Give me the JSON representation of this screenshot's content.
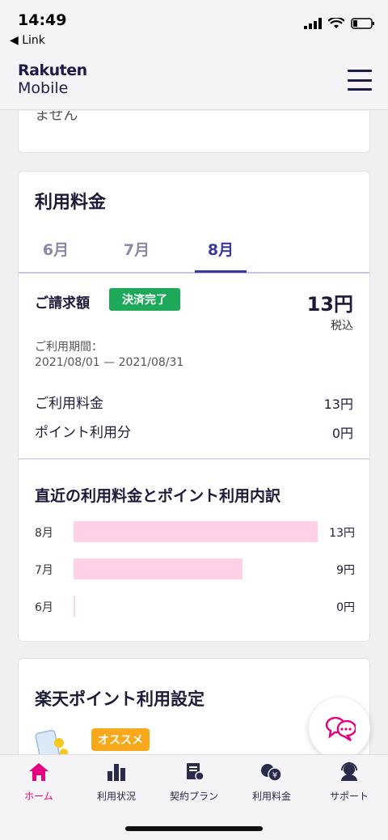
{
  "status_bar": {
    "time": "14:49",
    "back_label": "◀ Link"
  },
  "header": {
    "logo_line1": "Rakuten",
    "logo_line2": "Mobile",
    "menu_icon": "hamburger-menu-icon"
  },
  "top_card": {
    "text": "ません"
  },
  "fee_card": {
    "title": "利用料金",
    "tabs": [
      {
        "label": "6月"
      },
      {
        "label": "7月"
      },
      {
        "label": "8月",
        "active": true
      }
    ],
    "billing_label": "ご請求額",
    "status_badge": "決済完了",
    "amount": "13円",
    "tax_note": "税込",
    "period_label": "ご利用期間：",
    "period_value": "2021/08/01 — 2021/08/31",
    "rows": [
      {
        "label": "ご利用料金",
        "value": "13円"
      },
      {
        "label": "ポイント利用分",
        "value": "0円"
      }
    ],
    "breakdown_title": "直近の利用料金とポイント利用内訳",
    "breakdown": [
      {
        "month": "8月",
        "amount": 13,
        "label": "13円"
      },
      {
        "month": "7月",
        "amount": 9,
        "label": "9円"
      },
      {
        "month": "6月",
        "amount": 0,
        "label": "0円"
      }
    ],
    "bar_color": "#ffd0e8"
  },
  "point_card": {
    "title": "楽天ポイント利用設定",
    "badge": "オススメ"
  },
  "bottom_nav": [
    {
      "label": "ホーム",
      "icon": "home-icon",
      "active": true
    },
    {
      "label": "利用状況",
      "icon": "bar-chart-icon"
    },
    {
      "label": "契約プラン",
      "icon": "contract-document-icon"
    },
    {
      "label": "利用料金",
      "icon": "fee-coins-icon"
    },
    {
      "label": "サポート",
      "icon": "support-headset-icon"
    }
  ],
  "colors": {
    "accent": "#e4007f",
    "primary": "#3a3a9a",
    "success": "#1ea85a",
    "badge_orange": "#f7a81b"
  }
}
